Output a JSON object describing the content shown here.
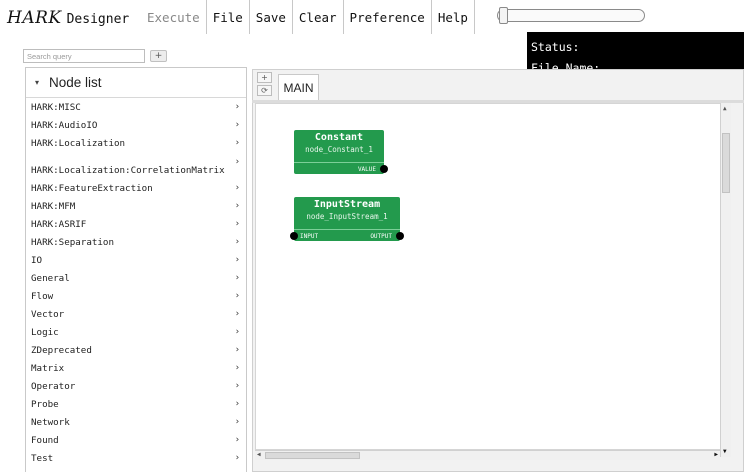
{
  "app": {
    "logo_hark": "HARK",
    "logo_designer": "Designer"
  },
  "menu": {
    "execute": "Execute",
    "file": "File",
    "save": "Save",
    "clear": "Clear",
    "preference": "Preference",
    "help": "Help"
  },
  "slider": {
    "value_fraction": 0.0
  },
  "status": {
    "status_label": "Status:",
    "filename_label": "File Name:"
  },
  "search": {
    "placeholder": "Search query",
    "add_label": "+"
  },
  "nodelist": {
    "title": "Node list",
    "caret": "▾",
    "items": [
      {
        "label": "HARK:MISC",
        "arrow": "›"
      },
      {
        "label": "HARK:AudioIO",
        "arrow": "›"
      },
      {
        "label": "HARK:Localization",
        "arrow": "›"
      },
      {
        "label": "HARK:Localization:CorrelationMatrix",
        "arrow": "›"
      },
      {
        "label": "HARK:FeatureExtraction",
        "arrow": "›"
      },
      {
        "label": "HARK:MFM",
        "arrow": "›"
      },
      {
        "label": "HARK:ASRIF",
        "arrow": "›"
      },
      {
        "label": "HARK:Separation",
        "arrow": "›"
      },
      {
        "label": "IO",
        "arrow": "›"
      },
      {
        "label": "General",
        "arrow": "›"
      },
      {
        "label": "Flow",
        "arrow": "›"
      },
      {
        "label": "Vector",
        "arrow": "›"
      },
      {
        "label": "Logic",
        "arrow": "›"
      },
      {
        "label": "ZDeprecated",
        "arrow": "›"
      },
      {
        "label": "Matrix",
        "arrow": "›"
      },
      {
        "label": "Operator",
        "arrow": "›"
      },
      {
        "label": "Probe",
        "arrow": "›"
      },
      {
        "label": "Network",
        "arrow": "›"
      },
      {
        "label": "Found",
        "arrow": "›"
      },
      {
        "label": "Test",
        "arrow": "›"
      }
    ]
  },
  "tabs": {
    "add_label": "+",
    "reload_label": "⟳",
    "main_label": "MAIN"
  },
  "scroll": {
    "mid_label": "III"
  },
  "nodes": [
    {
      "title": "Constant",
      "id": "node_Constant_1",
      "inputs": [],
      "outputs": [
        "VALUE"
      ]
    },
    {
      "title": "InputStream",
      "id": "node_InputStream_1",
      "inputs": [
        "INPUT"
      ],
      "outputs": [
        "OUTPUT"
      ]
    }
  ],
  "colors": {
    "node_fill": "#239a4d",
    "status_bg": "#000000"
  }
}
